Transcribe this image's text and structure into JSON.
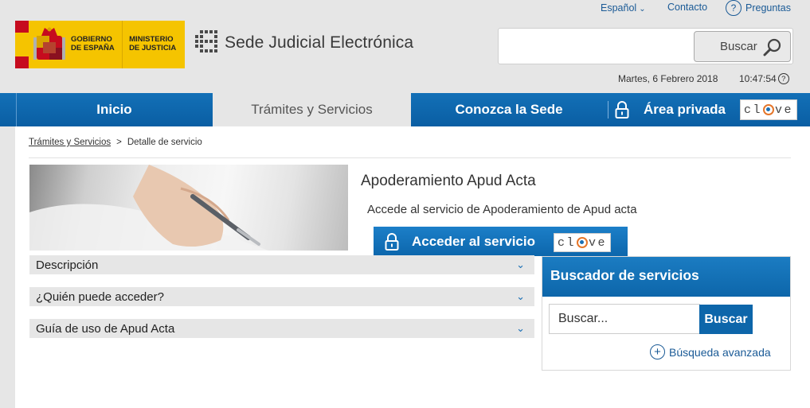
{
  "utility": {
    "language": "Español",
    "contact": "Contacto",
    "help": "Preguntas",
    "help_symbol": "?"
  },
  "header": {
    "gov_line1": "GOBIERNO",
    "gov_line2": "DE ESPAÑA",
    "ministry_line1": "MINISTERIO",
    "ministry_line2": "DE JUSTICIA",
    "site_name": "Sede Judicial Electrónica",
    "search_placeholder": "",
    "search_button": "Buscar",
    "date": "Martes, 6 Febrero 2018",
    "time": "10:47:54",
    "time_help": "?"
  },
  "nav": {
    "items": [
      {
        "label": "Inicio"
      },
      {
        "label": "Trámites y Servicios",
        "active": true
      },
      {
        "label": "Conozca la Sede"
      },
      {
        "label": "Área privada"
      }
    ],
    "clave_logo": "clave"
  },
  "breadcrumb": {
    "link": "Trámites y Servicios",
    "separator": ">",
    "current": "Detalle de servicio"
  },
  "service": {
    "title": "Apoderamiento Apud Acta",
    "description": "Accede al servicio de Apoderamiento de Apud acta",
    "access_button": "Acceder al servicio"
  },
  "accordion": [
    {
      "label": "Descripción"
    },
    {
      "label": "¿Quién puede acceder?"
    },
    {
      "label": "Guía de uso de Apud Acta"
    }
  ],
  "finder": {
    "title": "Buscador de servicios",
    "input_value": "Buscar...",
    "button": "Buscar",
    "advanced": "Búsqueda avanzada"
  },
  "colors": {
    "primary_blue": "#0d66aa",
    "flag_red": "#c60b1e",
    "flag_yellow": "#f5c400",
    "clave_orange": "#e5762a"
  }
}
